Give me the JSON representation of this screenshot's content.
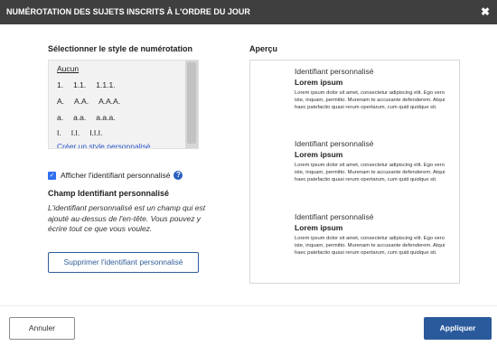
{
  "dialog": {
    "title": "NUMÉROTATION DES SUJETS INSCRITS À L'ORDRE DU JOUR",
    "close_icon": "✖"
  },
  "numbering": {
    "label": "Sélectionner le style de numérotation",
    "options": [
      {
        "label": "Aucun",
        "selected": true
      },
      {
        "c1": "1.",
        "c2": "1.1.",
        "c3": "1.1.1."
      },
      {
        "c1": "A.",
        "c2": "A.A.",
        "c3": "A.A.A."
      },
      {
        "c1": "a.",
        "c2": "a.a.",
        "c3": "a.a.a."
      },
      {
        "c1": "I.",
        "c2": "I.I.",
        "c3": "I.I.I."
      }
    ],
    "custom_link": "Créer un style personnalisé..."
  },
  "identifier": {
    "checkbox_label": "Afficher l'identifiant personnalisé",
    "checked": true,
    "help_icon": "?",
    "field_title": "Champ Identifiant personnalisé",
    "description": "L'identifiant personnalisé est un champ qui est ajouté au-dessus de l'en-tête. Vous pouvez y écrire tout ce que vous voulez.",
    "remove_button": "Supprimer l'identifiant personnalisé"
  },
  "preview": {
    "label": "Aperçu",
    "items": [
      {
        "identifier": "Identifiant personnalisé",
        "heading": "Lorem ipsum",
        "body": "Lorem ipsum dolor sit amet, consectetur adipiscing elit. Ego vero iste, inquam, permitto. Murenam te accusante defenderem. Atqui haec patefactio quasi rerum opertarum, cum quid quidque sit."
      },
      {
        "identifier": "Identifiant personnalisé",
        "heading": "Lorem ipsum",
        "body": "Lorem ipsum dolor sit amet, consectetur adipiscing elit. Ego vero iste, inquam, permitto. Murenam te accusante defenderem. Atqui haec patefactio quasi rerum opertarum, cum quid quidque sit."
      },
      {
        "identifier": "Identifiant personnalisé",
        "heading": "Lorem ipsum",
        "body": "Lorem ipsum dolor sit amet, consectetur adipiscing elit. Ego vero iste, inquam, permitto. Murenam te accusante defenderem. Atqui haec patefactio quasi rerum opertarum, cum quid quidque sit."
      }
    ]
  },
  "footer": {
    "cancel": "Annuler",
    "apply": "Appliquer"
  },
  "colors": {
    "titlebar": "#3f3f3f",
    "accent": "#2a5a9c",
    "link": "#2a55c8"
  }
}
